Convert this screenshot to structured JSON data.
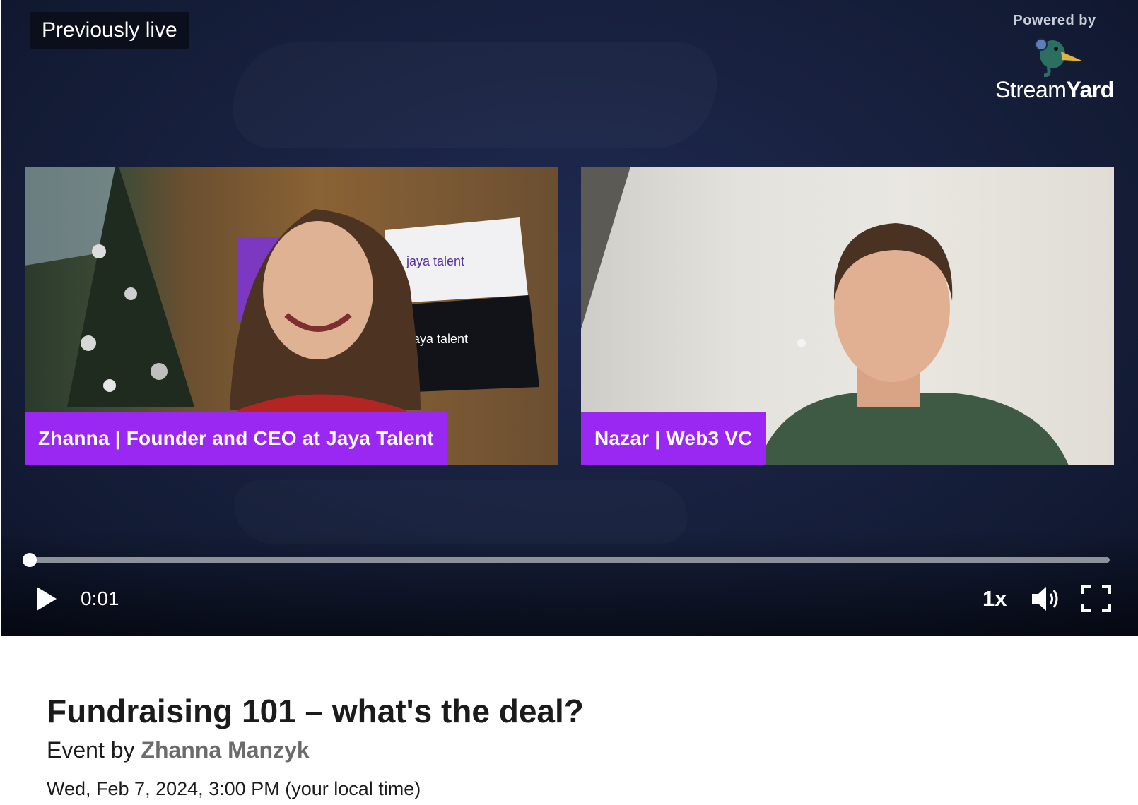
{
  "player": {
    "badge": "Previously live",
    "powered_by": "Powered by",
    "brand_name_light": "Stream",
    "brand_name_bold": "Yard",
    "participants": [
      {
        "label": "Zhanna | Founder and CEO at Jaya Talent"
      },
      {
        "label": "Nazar | Web3 VC"
      }
    ],
    "progress_fraction": 0.0,
    "time": "0:01",
    "speed": "1x",
    "icons": {
      "play": "play-icon",
      "volume": "volume-icon",
      "fullscreen": "fullscreen-icon"
    },
    "plate_color": "#9b28f2"
  },
  "event": {
    "title": "Fundraising 101 – what's the deal?",
    "byline_prefix": "Event by",
    "organizer": "Zhanna Manzyk",
    "datetime": "Wed, Feb 7, 2024, 3:00 PM (your local time)"
  }
}
